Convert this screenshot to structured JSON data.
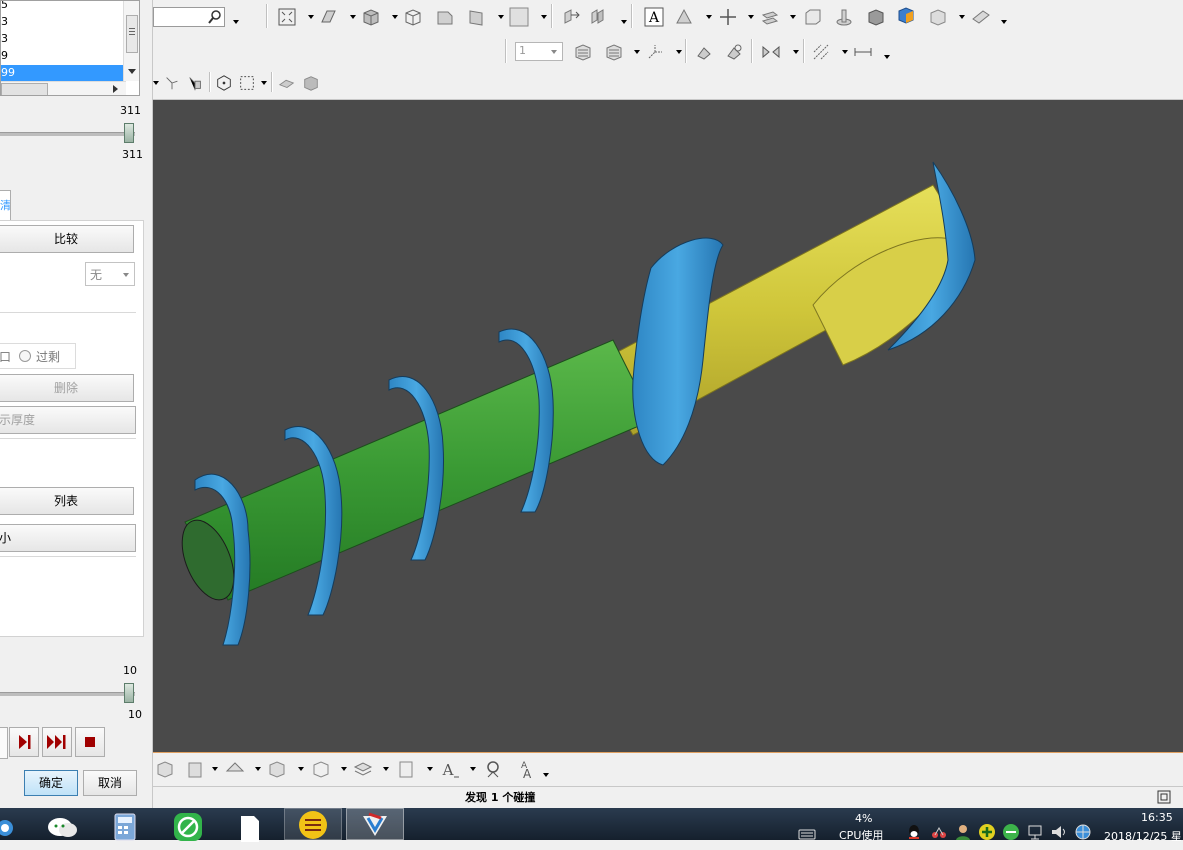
{
  "left_panel": {
    "list_items": [
      "5",
      "3",
      "3",
      "9",
      "99"
    ],
    "selected_index": 4,
    "slider_top": {
      "max_label": "311",
      "value_label": "311",
      "value": 311,
      "max": 311
    },
    "tab_label": "清",
    "compare_button": "比较",
    "dropdown_value": "无",
    "radio_left_label": "口",
    "radio_right_label": "过剩",
    "delete_button": "删除",
    "show_thickness_button": "示厚度",
    "list_button": "列表",
    "unnamed_button": "小",
    "slider_bottom": {
      "max_label": "10",
      "value_label": "10",
      "value": 10,
      "max": 10
    },
    "playback": [
      "play-step-icon",
      "play-end-icon",
      "stop-icon"
    ],
    "ok_button": "确定",
    "cancel_button": "取消"
  },
  "toolbar": {
    "search_placeholder": "",
    "layer_dropdown_value": "1"
  },
  "viewport": {
    "background": "#4a4a4a",
    "colors": {
      "blade": "#3a9ad6",
      "shaft_green": "#3c9a3c",
      "shaft_yellow": "#d4cc3e"
    }
  },
  "status": {
    "message": "发现 1 个碰撞"
  },
  "taskbar": {
    "cpu_percent": "4%",
    "cpu_label": "CPU使用",
    "time": "16:35",
    "date": "2018/12/25 星"
  }
}
